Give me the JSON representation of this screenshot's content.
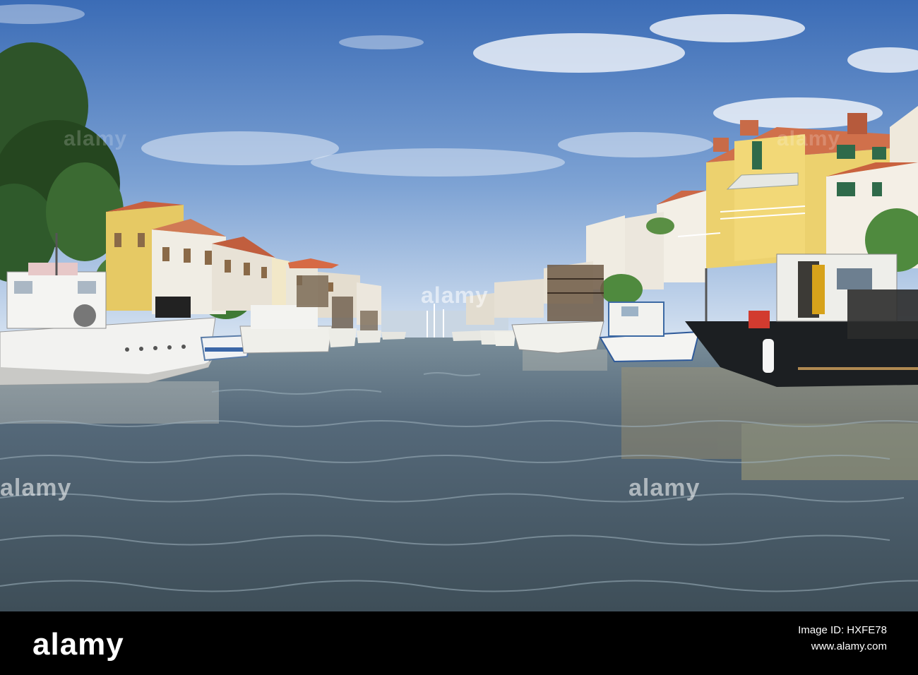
{
  "watermark": {
    "text": "alamy"
  },
  "footer": {
    "logo": "alamy",
    "image_id_label": "Image ID: HXFE78",
    "url": "www.alamy.com"
  },
  "colors": {
    "sky_top": "#3f6fb8",
    "sky_bottom": "#c9dbee",
    "water": "#4b5d68",
    "building_yellow": "#e9cf6a",
    "roof_terracotta": "#c8603f",
    "tree_green": "#2f5a2b",
    "boat_white": "#f2f2f0",
    "boat_black": "#1c1f22"
  }
}
